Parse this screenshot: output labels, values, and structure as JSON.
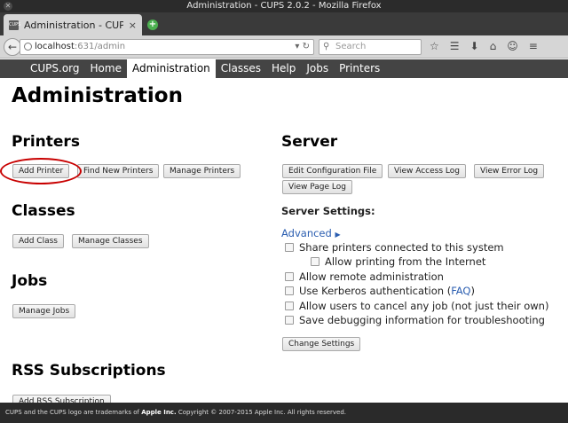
{
  "window": {
    "title": "Administration - CUPS 2.0.2 - Mozilla Firefox"
  },
  "tab": {
    "title": "Administration - CUPS ...",
    "favicon_text": "CUPS"
  },
  "navbar": {
    "url_host": "localhost",
    "url_path": ":631/admin",
    "search_placeholder": "Search"
  },
  "menu": {
    "items": [
      "CUPS.org",
      "Home",
      "Administration",
      "Classes",
      "Help",
      "Jobs",
      "Printers"
    ],
    "active": "Administration"
  },
  "page": {
    "title": "Administration",
    "printers": {
      "heading": "Printers",
      "buttons": [
        "Add Printer",
        "Find New Printers",
        "Manage Printers"
      ]
    },
    "classes": {
      "heading": "Classes",
      "buttons": [
        "Add Class",
        "Manage Classes"
      ]
    },
    "jobs": {
      "heading": "Jobs",
      "buttons": [
        "Manage Jobs"
      ]
    },
    "rss": {
      "heading": "RSS Subscriptions",
      "buttons": [
        "Add RSS Subscription"
      ]
    },
    "server": {
      "heading": "Server",
      "buttons": [
        "Edit Configuration File",
        "View Access Log",
        "View Error Log",
        "View Page Log"
      ],
      "settings_label": "Server Settings:",
      "advanced_label": "Advanced",
      "options": [
        {
          "label": "Share printers connected to this system",
          "checked": false
        },
        {
          "label": "Allow printing from the Internet",
          "checked": false
        },
        {
          "label": "Allow remote administration",
          "checked": false
        },
        {
          "label": "Use Kerberos authentication (",
          "link": "FAQ",
          "suffix": ")",
          "checked": false
        },
        {
          "label": "Allow users to cancel any job (not just their own)",
          "checked": false
        },
        {
          "label": "Save debugging information for troubleshooting",
          "checked": false
        }
      ],
      "change_button": "Change Settings"
    }
  },
  "footer": {
    "text_before": "CUPS and the CUPS logo are trademarks of ",
    "brand": "Apple Inc.",
    "text_after": " Copyright © 2007-2015 Apple Inc. All rights reserved."
  },
  "colors": {
    "menu_bg": "#444444",
    "link": "#2a5db0",
    "highlight_circle": "#c80000",
    "footer_bg": "#2a2a2a"
  }
}
